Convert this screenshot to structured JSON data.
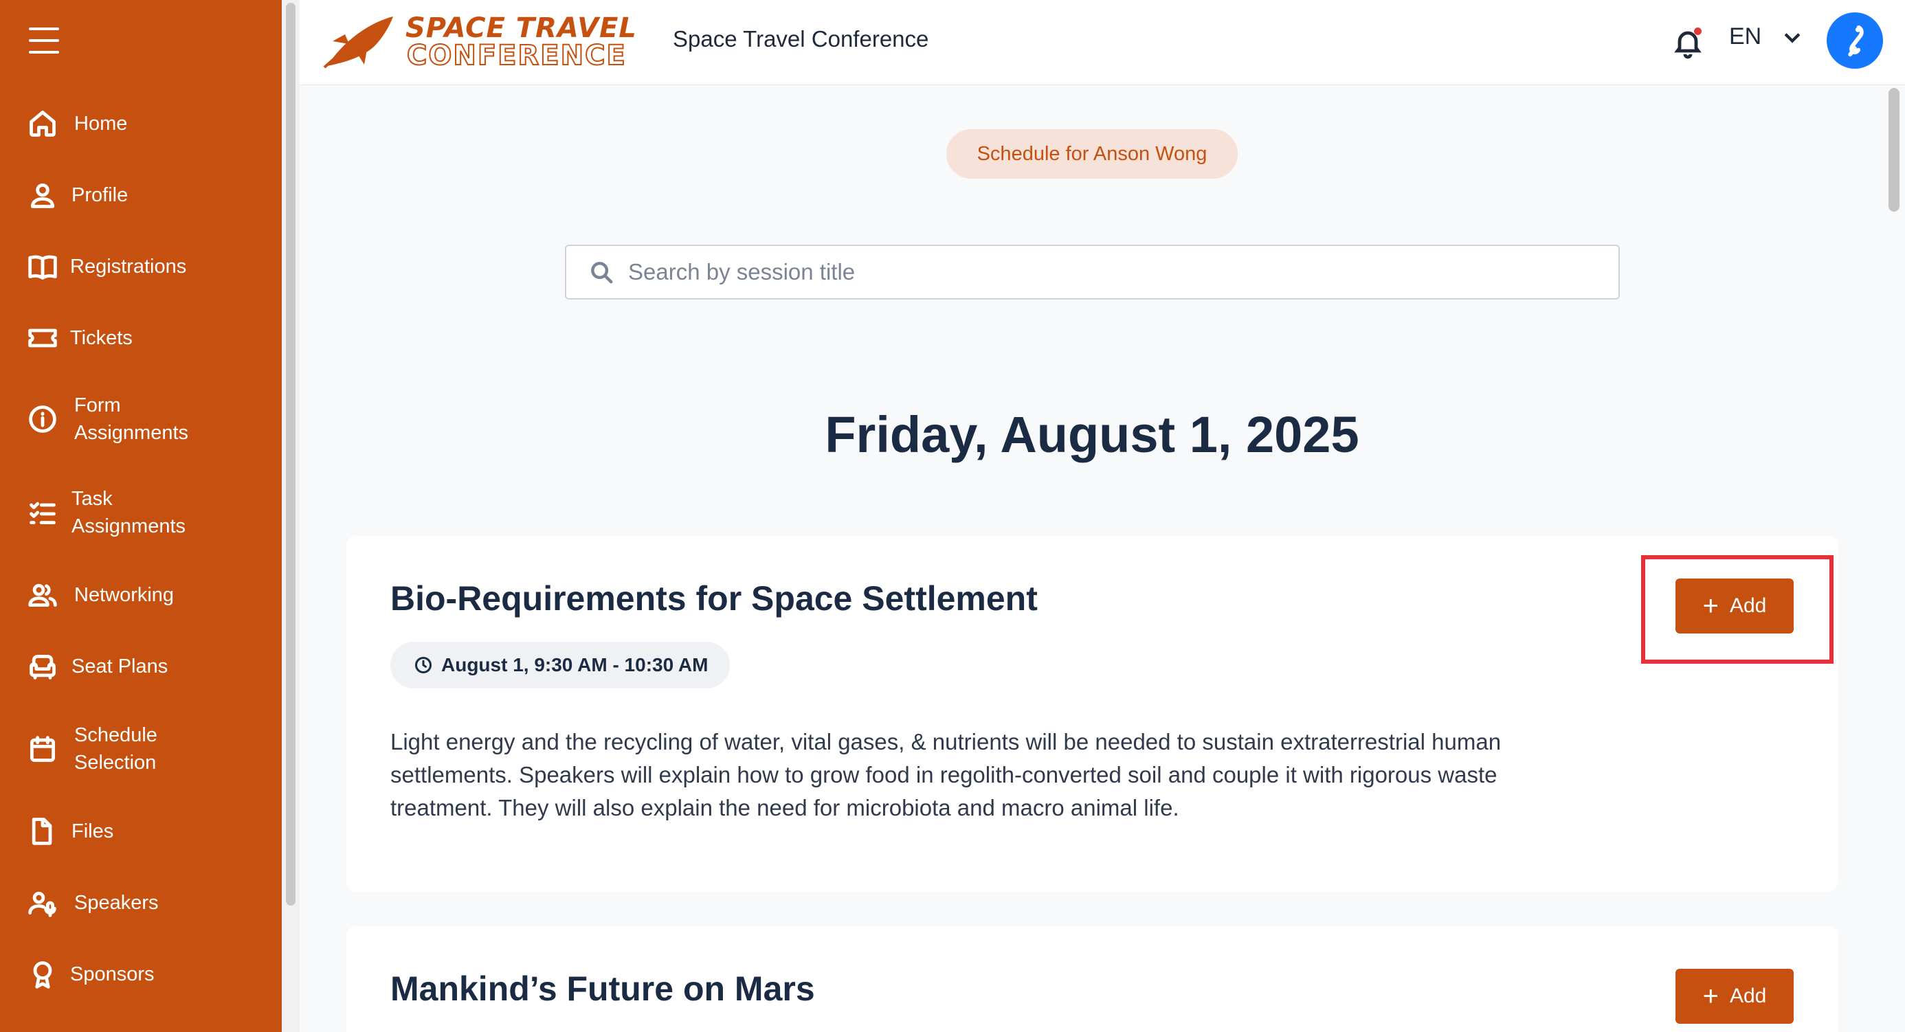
{
  "sidebar": {
    "items": [
      {
        "label": "Home",
        "icon": "home-icon"
      },
      {
        "label": "Profile",
        "icon": "user-icon"
      },
      {
        "label": "Registrations",
        "icon": "book-icon"
      },
      {
        "label": "Tickets",
        "icon": "ticket-icon"
      },
      {
        "label_line1": "Form",
        "label_line2": "Assignments",
        "icon": "info-icon"
      },
      {
        "label_line1": "Task",
        "label_line2": "Assignments",
        "icon": "checklist-icon"
      },
      {
        "label": "Networking",
        "icon": "users-icon"
      },
      {
        "label": "Seat Plans",
        "icon": "sofa-icon"
      },
      {
        "label_line1": "Schedule",
        "label_line2": "Selection",
        "icon": "calendar-icon"
      },
      {
        "label": "Files",
        "icon": "file-icon"
      },
      {
        "label": "Speakers",
        "icon": "speaker-icon"
      },
      {
        "label": "Sponsors",
        "icon": "award-icon"
      }
    ]
  },
  "header": {
    "logo_line1": "SPACE TRAVEL",
    "logo_line2": "CONFERENCE",
    "title": "Space Travel Conference",
    "language": "EN"
  },
  "main": {
    "schedule_for": "Schedule for Anson Wong",
    "search_placeholder": "Search by session title",
    "date_heading": "Friday, August 1, 2025",
    "sessions": [
      {
        "title": "Bio-Requirements for Space Settlement",
        "time": "August 1, 9:30 AM - 10:30 AM",
        "description_line1": "Light energy and the recycling of water, vital gases, & nutrients will be needed to sustain extraterrestrial human",
        "description_line2": "settlements. Speakers will explain how to grow food in regolith-converted soil and couple it with rigorous waste",
        "description_line3": "treatment. They will also explain the need for microbiota and macro animal life.",
        "add_label": "Add"
      },
      {
        "title": "Mankind’s Future on Mars",
        "add_label": "Add"
      }
    ]
  },
  "colors": {
    "brand": "#c5500f",
    "highlight": "#e8303a",
    "avatar": "#1677ff"
  }
}
